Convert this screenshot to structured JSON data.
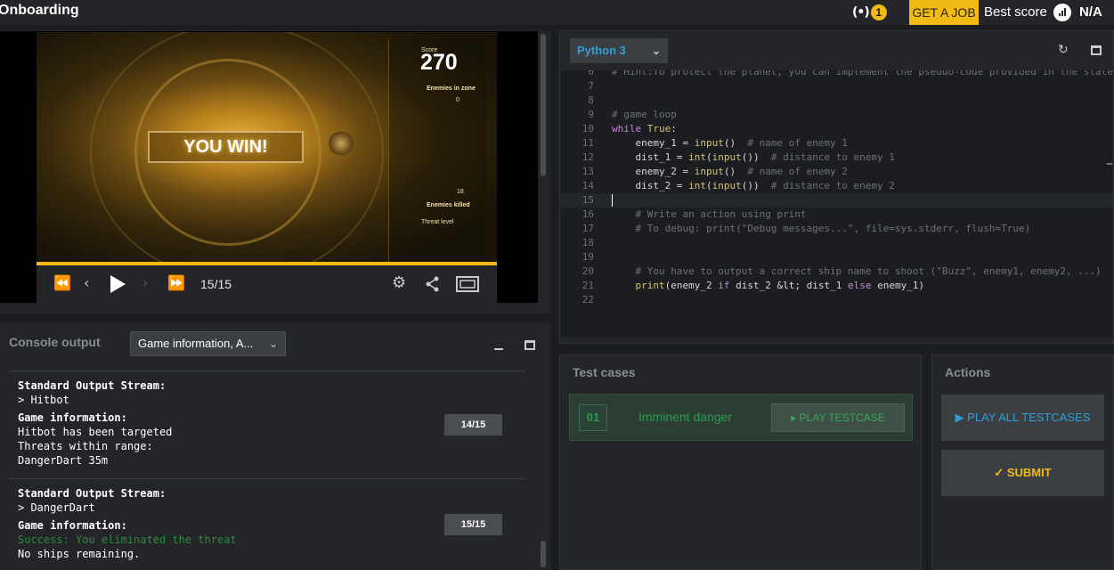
{
  "header": {
    "title": "Onboarding",
    "live_count": "1",
    "live_icon": "broadcast-icon",
    "get_job_label": "GET A JOB",
    "best_score_label": "Best score",
    "best_score_value": "N/A",
    "accent_color": "#f2bb13"
  },
  "viewer": {
    "score_label": "Score",
    "score_value": "270",
    "enemies_in_zone_label": "Enemies in zone",
    "enemies_in_zone_value": "0",
    "enemies_killed_value": "18",
    "enemies_killed_label": "Enemies killed",
    "threat_level_label": "Threat level",
    "banner": "YOU WIN!",
    "frame_counter": "15/15",
    "progress": 1.0
  },
  "console": {
    "title": "Console output",
    "filter_value": "Game information, A...",
    "turns": [
      {
        "stdout_label": "Standard Output Stream:",
        "stdout": "> Hitbot",
        "info_label": "Game information:",
        "info_lines": [
          "Hitbot has been targeted",
          "Threats within range:",
          "DangerDart 35m"
        ],
        "badge": "14/15"
      },
      {
        "stdout_label": "Standard Output Stream:",
        "stdout": "> DangerDart",
        "info_label": "Game information:",
        "success": "Success: You eliminated the threat",
        "info_lines": [
          "No ships remaining."
        ],
        "badge": "15/15"
      }
    ]
  },
  "editor": {
    "language": "Python 3",
    "lines": [
      {
        "n": "6",
        "text": "# Hint:To protect the planet, you can implement the pseudo-code provided in the statem"
      },
      {
        "n": "7",
        "text": ""
      },
      {
        "n": "8",
        "text": ""
      },
      {
        "n": "9",
        "text": "# game loop"
      },
      {
        "n": "10",
        "text": "while True:"
      },
      {
        "n": "11",
        "text": "    enemy_1 = input()  # name of enemy 1"
      },
      {
        "n": "12",
        "text": "    dist_1 = int(input())  # distance to enemy 1"
      },
      {
        "n": "13",
        "text": "    enemy_2 = input()  # name of enemy 2"
      },
      {
        "n": "14",
        "text": "    dist_2 = int(input())  # distance to enemy 2"
      },
      {
        "n": "15",
        "text": ""
      },
      {
        "n": "16",
        "text": "    # Write an action using print"
      },
      {
        "n": "17",
        "text": "    # To debug: print(\"Debug messages...\", file=sys.stderr, flush=True)"
      },
      {
        "n": "18",
        "text": ""
      },
      {
        "n": "19",
        "text": ""
      },
      {
        "n": "20",
        "text": "    # You have to output a correct ship name to shoot (\"Buzz\", enemy1, enemy2, ...)"
      },
      {
        "n": "21",
        "text": "    print(enemy_2 if dist_2 < dist_1 else enemy_1)"
      },
      {
        "n": "22",
        "text": ""
      }
    ]
  },
  "testcases": {
    "title": "Test cases",
    "items": [
      {
        "num": "01",
        "name": "Imminent danger",
        "play_label": "▸ PLAY TESTCASE"
      }
    ]
  },
  "actions": {
    "title": "Actions",
    "play_all_label": "▶ PLAY ALL TESTCASES",
    "submit_label": "✓  SUBMIT"
  }
}
